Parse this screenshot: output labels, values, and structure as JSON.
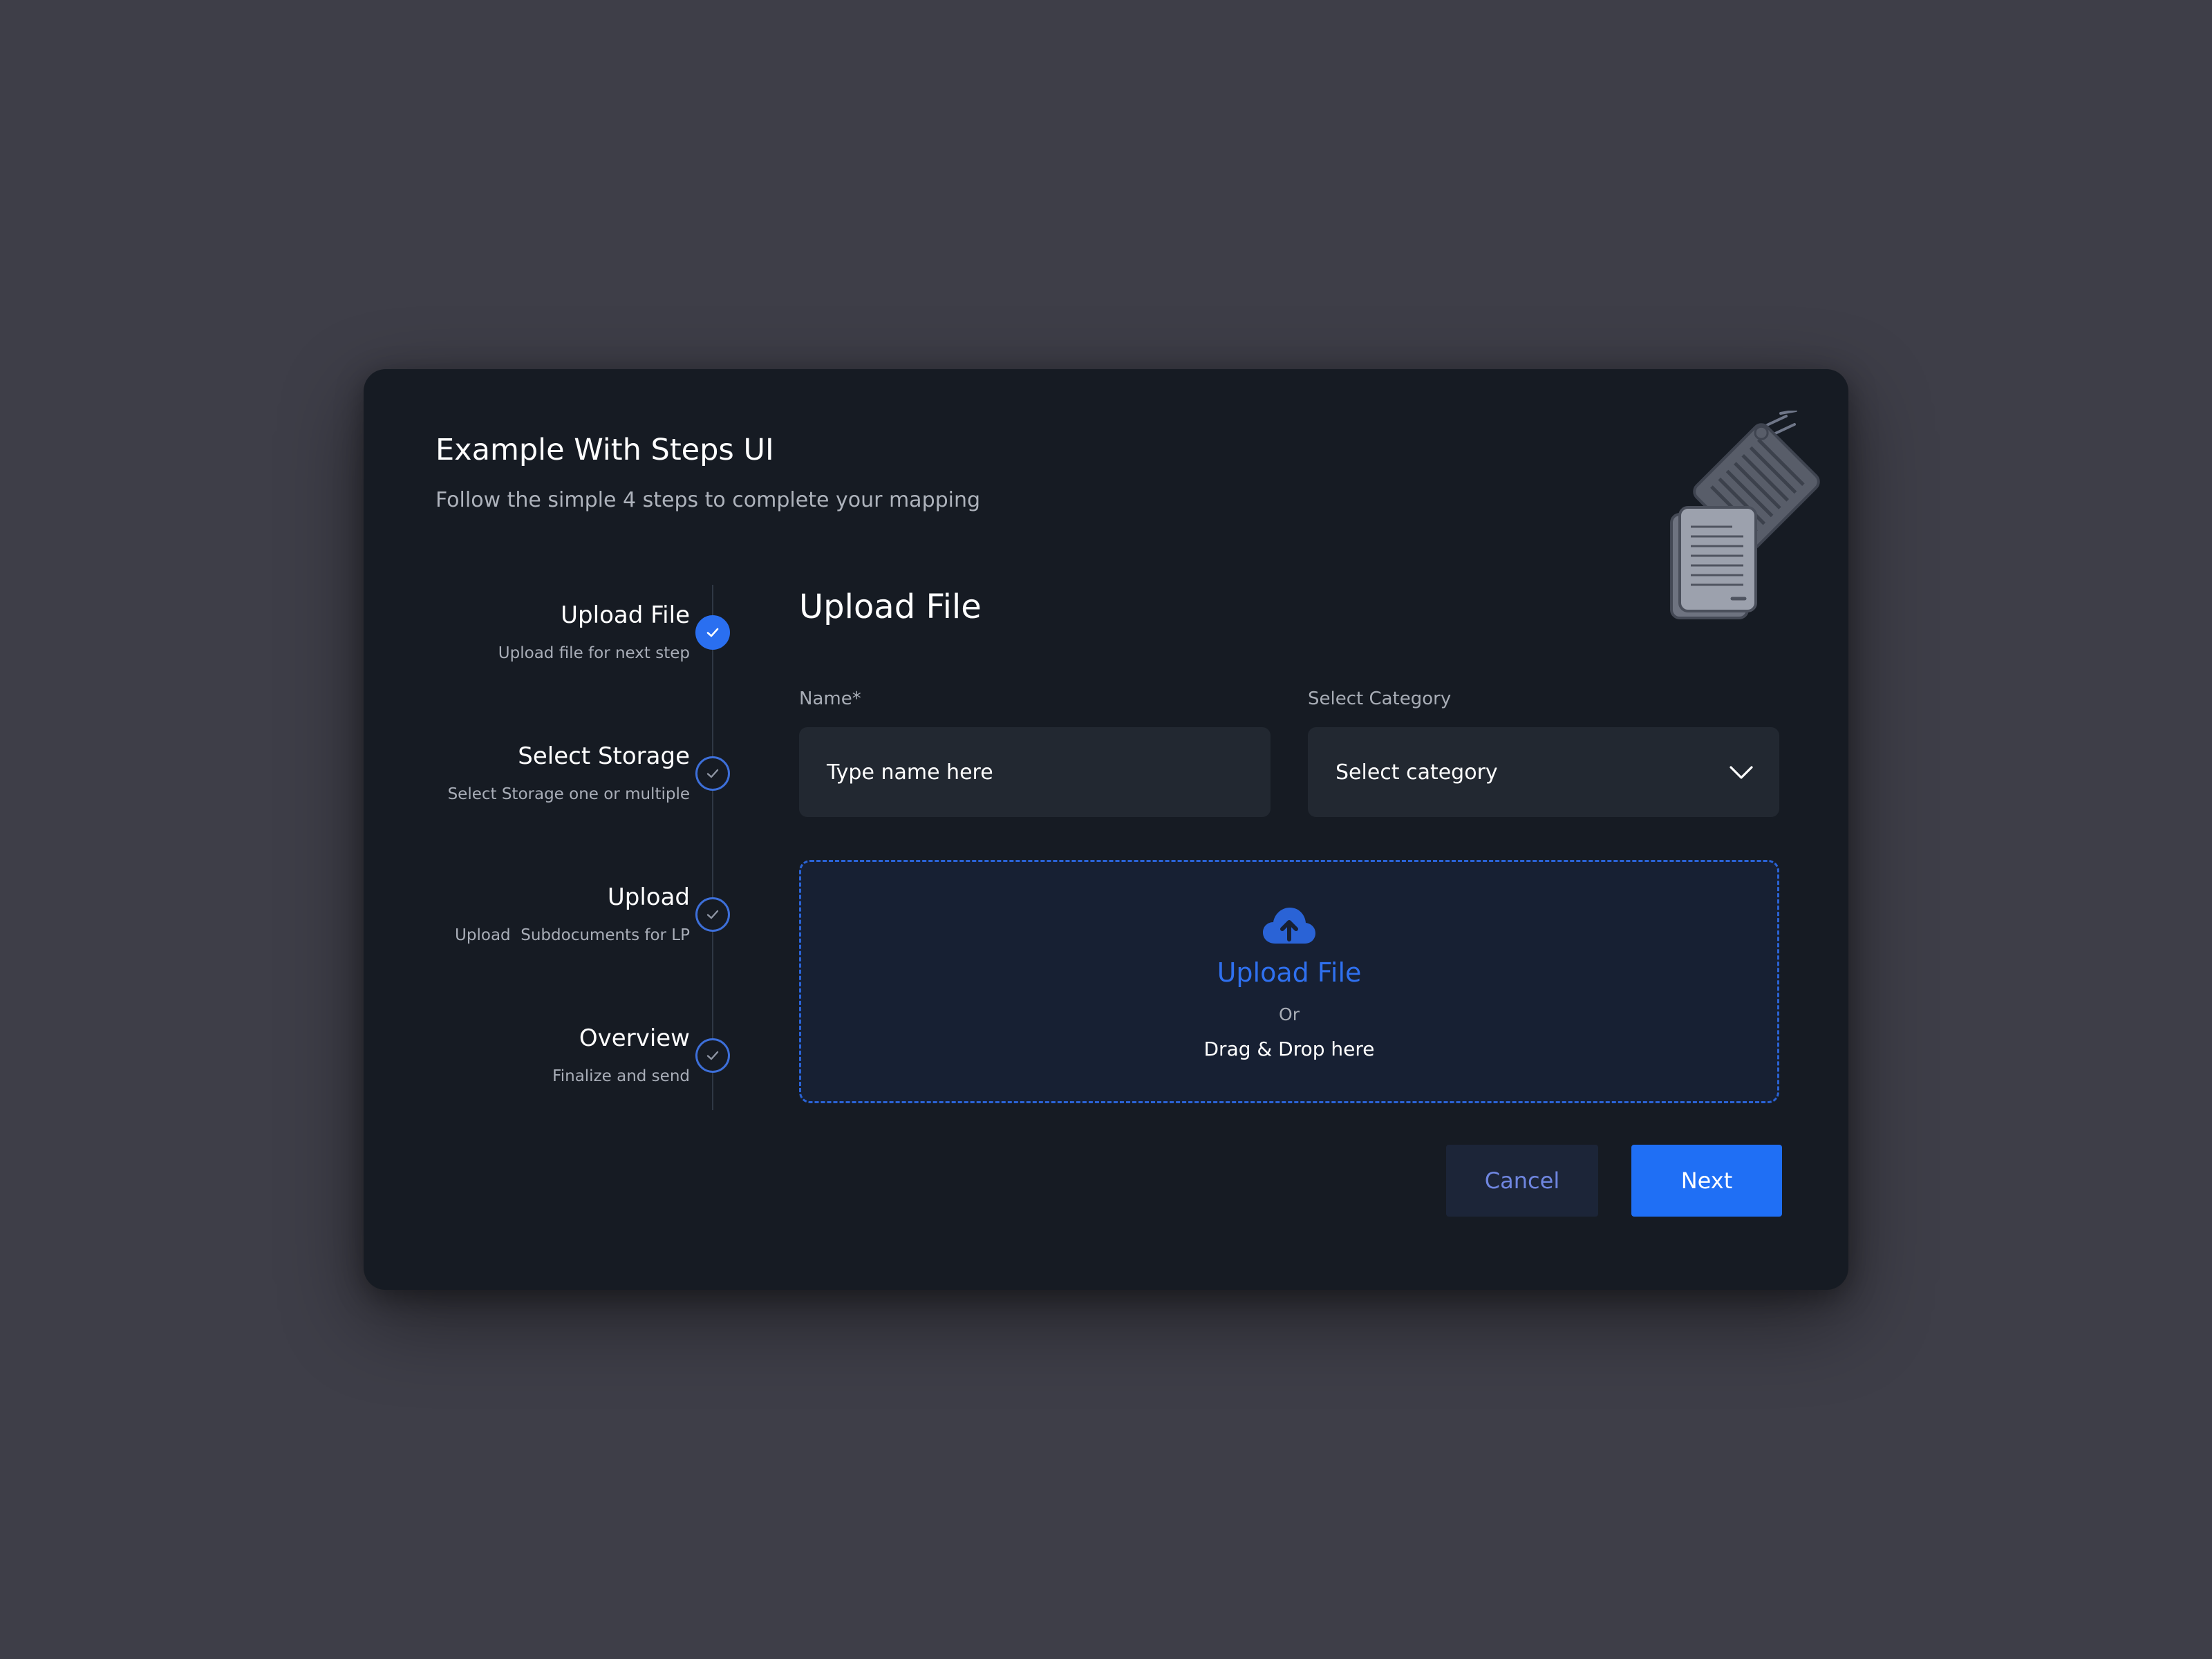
{
  "header": {
    "title": "Example With Steps UI",
    "subtitle": "Follow the simple 4 steps to complete your mapping"
  },
  "steps": [
    {
      "title": "Upload File",
      "description": "Upload file for next step",
      "state": "active"
    },
    {
      "title": "Select Storage",
      "description": "Select Storage one or multiple",
      "state": "pending"
    },
    {
      "title": "Upload",
      "description": "Upload  Subdocuments for LP",
      "state": "pending"
    },
    {
      "title": "Overview",
      "description": "Finalize and send",
      "state": "pending"
    }
  ],
  "content": {
    "section_title": "Upload File",
    "name_field": {
      "label": "Name*",
      "placeholder": "Type name here"
    },
    "category_field": {
      "label": "Select Category",
      "value": "Select category"
    },
    "dropzone": {
      "icon": "cloud-upload-icon",
      "main": "Upload File",
      "or": "Or",
      "hint": "Drag & Drop here"
    }
  },
  "actions": {
    "cancel": "Cancel",
    "next": "Next"
  },
  "colors": {
    "accent": "#1f6ff5",
    "modal_background": "#161b23",
    "page_background": "#3e3e48"
  }
}
